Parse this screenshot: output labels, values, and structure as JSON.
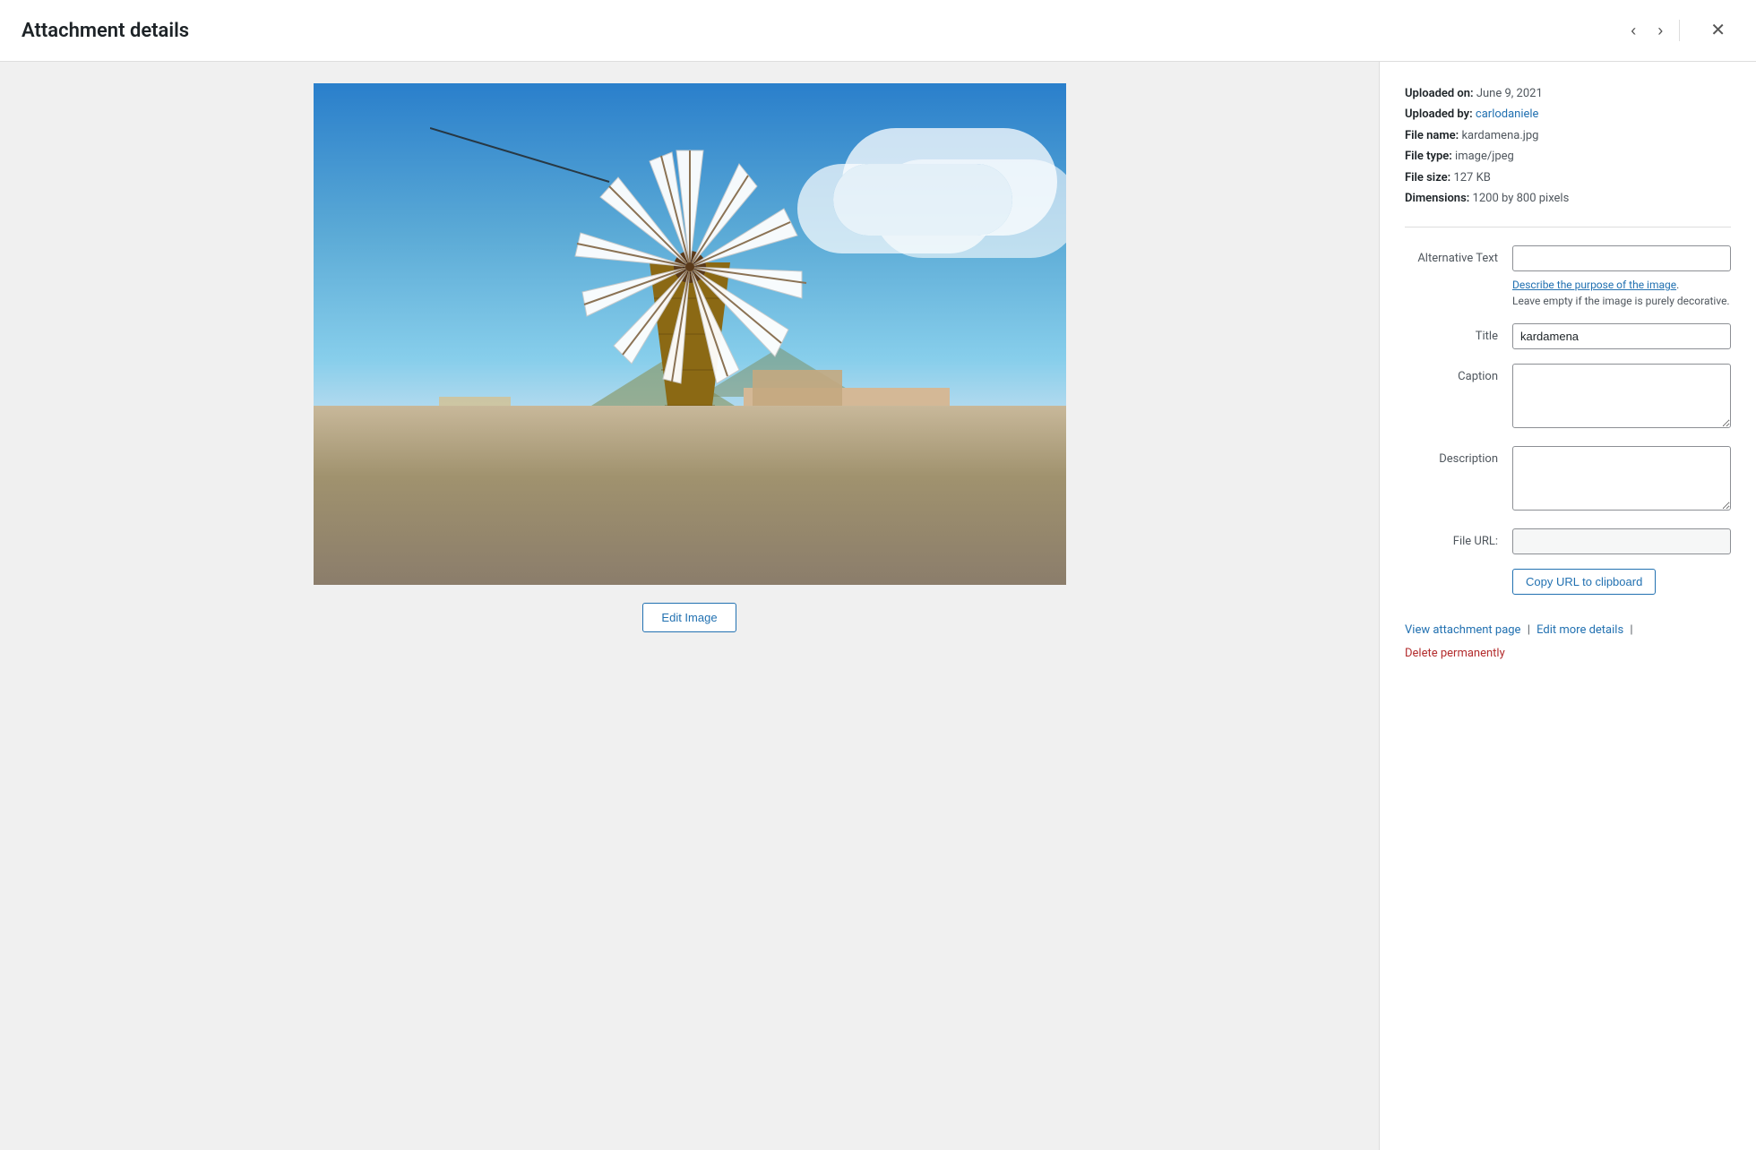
{
  "header": {
    "title": "Attachment details",
    "prev_label": "‹",
    "next_label": "›",
    "close_label": "✕"
  },
  "meta": {
    "uploaded_on_label": "Uploaded on:",
    "uploaded_on_value": "June 9, 2021",
    "uploaded_by_label": "Uploaded by:",
    "uploaded_by_value": "carlodaniele",
    "file_name_label": "File name:",
    "file_name_value": "kardamena.jpg",
    "file_type_label": "File type:",
    "file_type_value": "image/jpeg",
    "file_size_label": "File size:",
    "file_size_value": "127 KB",
    "dimensions_label": "Dimensions:",
    "dimensions_value": "1200 by 800 pixels"
  },
  "form": {
    "alt_text_label": "Alternative Text",
    "alt_text_value": "",
    "alt_text_link": "Describe the purpose of the image",
    "alt_text_help": "Leave empty if the image is purely decorative.",
    "title_label": "Title",
    "title_value": "kardamena",
    "caption_label": "Caption",
    "caption_value": "",
    "description_label": "Description",
    "description_value": "",
    "file_url_label": "File URL:",
    "file_url_value": ""
  },
  "buttons": {
    "edit_image": "Edit Image",
    "copy_url": "Copy URL to clipboard"
  },
  "footer": {
    "view_attachment": "View attachment page",
    "separator": "|",
    "edit_more": "Edit more details",
    "separator2": "|",
    "delete": "Delete permanently"
  }
}
